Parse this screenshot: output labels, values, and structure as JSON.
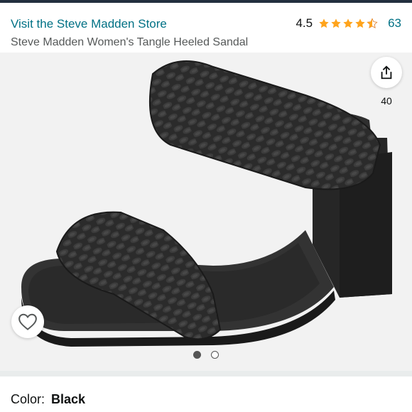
{
  "header": {
    "store_link": "Visit the Steve Madden Store",
    "rating_value": "4.5",
    "review_count": "63",
    "product_title": "Steve Madden Women's Tangle Heeled Sandal",
    "stars": 4.5
  },
  "gallery": {
    "share_count": "40",
    "image_count": 2,
    "active_index": 0
  },
  "variant": {
    "color_label": "Color:",
    "color_value": "Black"
  },
  "colors": {
    "link": "#007185",
    "star": "#ffa41c",
    "gallery_bg": "#f2f2f2",
    "divider": "#e9ecec"
  },
  "icons": {
    "share": "share-icon",
    "wishlist": "heart-icon"
  }
}
